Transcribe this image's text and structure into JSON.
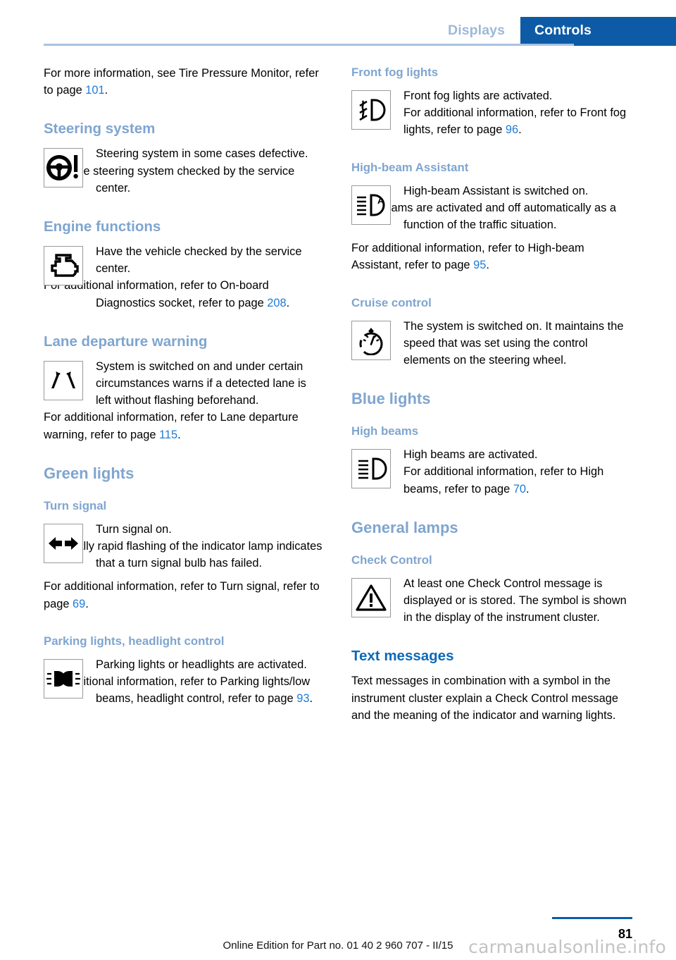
{
  "header": {
    "tabs": [
      {
        "label": "Displays",
        "active": false
      },
      {
        "label": "Controls",
        "active": true
      }
    ],
    "accent_active_bg": "#0d5ba6",
    "accent_inactive_text": "#9db8d8"
  },
  "colors": {
    "section_heading": "#7fa5cf",
    "strong_heading": "#0d69b8",
    "page_ref_link": "#1f7bd6",
    "body_text": "#000000"
  },
  "left_column": {
    "intro": {
      "text_before": "For more information, see Tire Pressure Monitor, refer to page ",
      "page_ref": "101",
      "text_after": "."
    },
    "steering": {
      "heading": "Steering system",
      "icon": "steering-wheel-warning-icon",
      "line1": "Steering system in some cases defective.",
      "line2": "Have the steering system checked by the service center."
    },
    "engine": {
      "heading": "Engine functions",
      "icon": "check-engine-icon",
      "line1": "Have the vehicle checked by the service center.",
      "line2_before": "For additional information, refer to On-board Diagnostics socket, refer to page ",
      "line2_ref": "208",
      "line2_after": "."
    },
    "lane": {
      "heading": "Lane departure warning",
      "icon": "lane-departure-icon",
      "line1": "System is switched on and under certain circumstances warns if a detected lane is left without flashing beforehand.",
      "line2_before": "For additional information, refer to Lane departure warning, refer to page ",
      "line2_ref": "115",
      "line2_after": "."
    },
    "green_lights": {
      "heading": "Green lights"
    },
    "turn_signal": {
      "heading": "Turn signal",
      "icon": "turn-signal-arrows-icon",
      "line1": "Turn signal on.",
      "line2": "Unusually rapid flashing of the indicator lamp indicates that a turn signal bulb has failed.",
      "line3_before": "For additional information, refer to Turn signal, refer to page ",
      "line3_ref": "69",
      "line3_after": "."
    },
    "parking_lights": {
      "heading": "Parking lights, headlight control",
      "icon": "parking-lights-icon",
      "line1": "Parking lights or headlights are activated.",
      "line2_before": "For additional information, refer to Parking lights/low beams, headlight control, refer to page ",
      "line2_ref": "93",
      "line2_after": "."
    }
  },
  "right_column": {
    "front_fog": {
      "heading": "Front fog lights",
      "icon": "front-fog-light-icon",
      "line1": "Front fog lights are activated.",
      "line2_before": "For additional information, refer to Front fog lights, refer to page ",
      "line2_ref": "96",
      "line2_after": "."
    },
    "high_beam_assistant": {
      "heading": "High-beam Assistant",
      "icon": "high-beam-assistant-icon",
      "line1": "High-beam Assistant is switched on.",
      "line2": "High beams are activated and off automatically as a function of the traffic situation.",
      "line3_before": "For additional information, refer to High-beam Assistant, refer to page ",
      "line3_ref": "95",
      "line3_after": "."
    },
    "cruise_control": {
      "heading": "Cruise control",
      "icon": "cruise-control-gauge-icon",
      "line1": "The system is switched on. It maintains the speed that was set using the control elements on the steering wheel."
    },
    "blue_lights": {
      "heading": "Blue lights"
    },
    "high_beams": {
      "heading": "High beams",
      "icon": "high-beam-icon",
      "line1": "High beams are activated.",
      "line2_before": "For additional information, refer to High beams, refer to page ",
      "line2_ref": "70",
      "line2_after": "."
    },
    "general_lamps": {
      "heading": "General lamps"
    },
    "check_control": {
      "heading": "Check Control",
      "icon": "warning-triangle-icon",
      "line1": "At least one Check Control message is displayed or is stored. The symbol is shown in the display of the instrument cluster."
    },
    "text_messages": {
      "heading": "Text messages",
      "body": "Text messages in combination with a symbol in the instrument cluster explain a Check Control message and the meaning of the indicator and warning lights."
    }
  },
  "footer": {
    "edition": "Online Edition for Part no. 01 40 2 960 707 - II/15",
    "page_number": "81",
    "watermark": "carmanualsonline.info"
  }
}
